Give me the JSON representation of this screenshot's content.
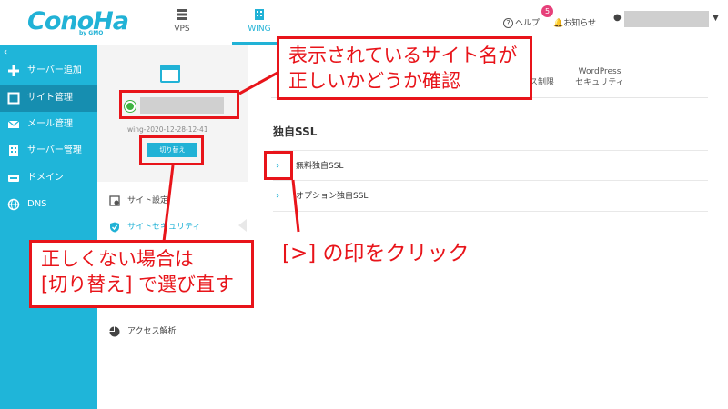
{
  "brand": {
    "logo": "ConoHa",
    "logo_sub": "by GMO",
    "accent": "#21b2d6",
    "sidebar_color": "#1fb5d9"
  },
  "top_tabs": [
    {
      "label": "VPS",
      "icon": "server-icon",
      "active": false
    },
    {
      "label": "WING",
      "icon": "building-icon",
      "active": true
    }
  ],
  "top_right": {
    "help": "ヘルプ",
    "notice": "お知らせ",
    "notice_badge": "5"
  },
  "sidebar": {
    "items": [
      {
        "label": "サーバー追加",
        "icon": "plus-icon"
      },
      {
        "label": "サイト管理",
        "icon": "window-icon",
        "active": true
      },
      {
        "label": "メール管理",
        "icon": "mail-icon"
      },
      {
        "label": "サーバー管理",
        "icon": "server-icon"
      },
      {
        "label": "ドメイン",
        "icon": "domain-icon"
      },
      {
        "label": "DNS",
        "icon": "globe-icon"
      }
    ]
  },
  "site_panel": {
    "site_id": "wing-2020-12-28-12-41",
    "switch_label": "切り替え",
    "menu": [
      {
        "label": "サイト設定",
        "icon": "gear-icon"
      },
      {
        "label": "サイトセキュリティ",
        "icon": "shield-icon",
        "active": true
      },
      {
        "label": "アクセス解析",
        "icon": "pie-chart-icon"
      }
    ]
  },
  "main": {
    "tabs": [
      {
        "label": "ス制限"
      },
      {
        "label": "WordPress\nセキュリティ"
      }
    ],
    "section_title": "独自SSL",
    "rows": [
      {
        "label": "無料独自SSL"
      },
      {
        "label": "オプション独自SSL"
      }
    ]
  },
  "callouts": {
    "site_name": "表示されているサイト名が\n正しいかどうか確認",
    "switch": "正しくない場合は\n[切り替え] で選び直す",
    "chevron": "[>] の印をクリック"
  }
}
